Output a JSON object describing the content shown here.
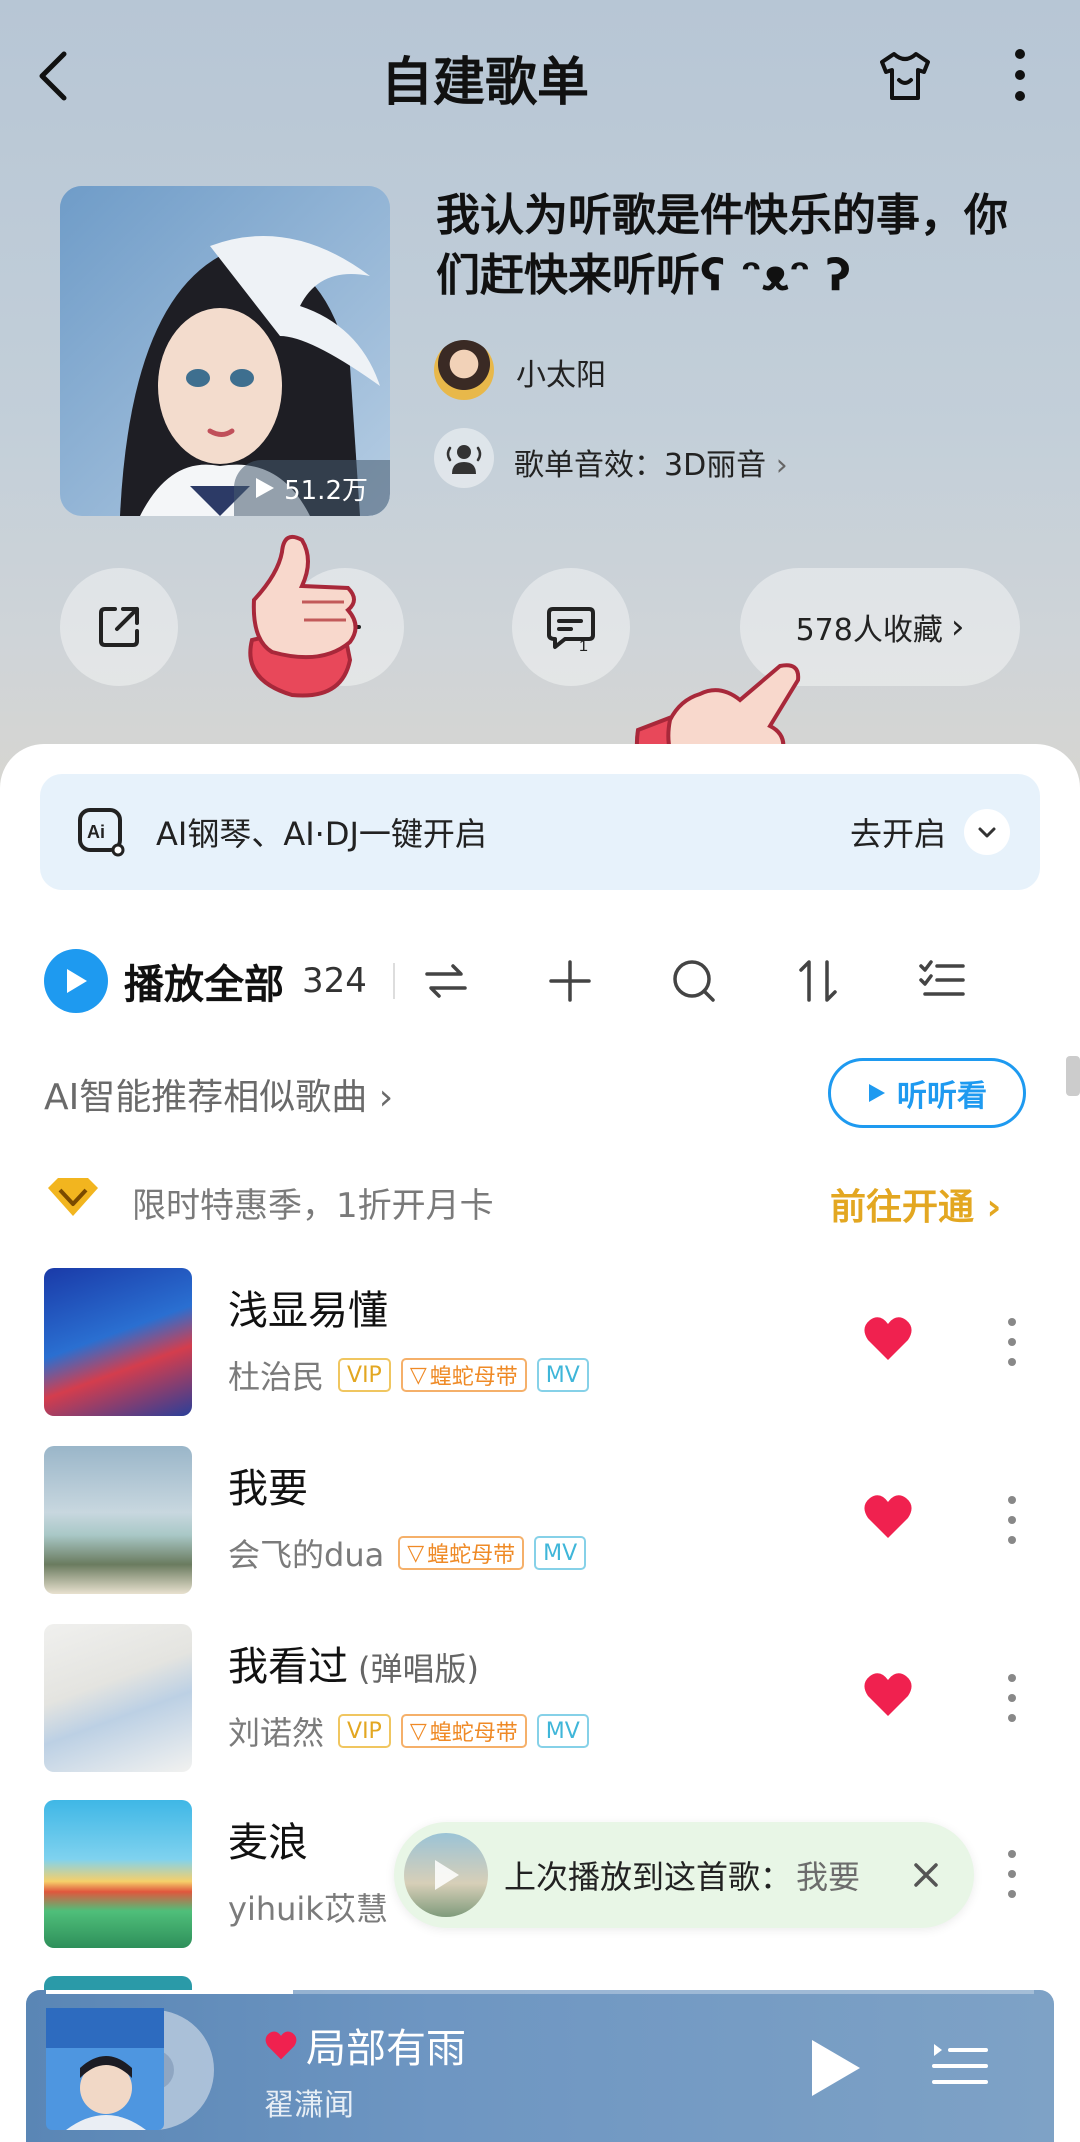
{
  "header": {
    "title": "自建歌单",
    "back_icon": "chevron-left-icon",
    "skin_icon": "tshirt-icon",
    "more_icon": "more-vertical-icon"
  },
  "playlist": {
    "title": "我认为听歌是件快乐的事，你们赶快来听听ʕ ᵔᴥᵔ ʔ",
    "play_count": "51.2万",
    "creator": "小太阳",
    "sound_effect": "歌单音效：3D丽音",
    "favorites": "578人收藏"
  },
  "actions": {
    "share_icon": "share-icon",
    "add_icon": "add-icon",
    "comment_icon": "comment-icon",
    "comment_count": "1"
  },
  "ai_bar": {
    "text": "AI钢琴、AI·DJ一键开启",
    "action": "去开启"
  },
  "toolbar": {
    "play_all": "播放全部",
    "count": "324"
  },
  "ai_recommend": {
    "text": "AI智能推荐相似歌曲 ›",
    "button": "听听看"
  },
  "promo": {
    "text": "限时特惠季，1折开月卡",
    "link": "前往开通 ›"
  },
  "songs": [
    {
      "name": "浅显易懂",
      "subtitle": "",
      "artist": "杜治民",
      "vip": "VIP",
      "theme": "蝗蛇母带",
      "mv": "MV",
      "liked": true
    },
    {
      "name": "我要",
      "subtitle": "",
      "artist": "会飞的dua",
      "vip": "",
      "theme": "蝗蛇母带",
      "mv": "MV",
      "liked": true
    },
    {
      "name": "我看过",
      "subtitle": "(弹唱版)",
      "artist": "刘诺然",
      "vip": "VIP",
      "theme": "蝗蛇母带",
      "mv": "MV",
      "liked": true
    },
    {
      "name": "麦浪",
      "subtitle": "",
      "artist": "yihuik苡慧",
      "vip": "",
      "theme": "",
      "mv": "",
      "liked": false
    }
  ],
  "resume_toast": {
    "label": "上次播放到这首歌：",
    "song": "我要"
  },
  "mini_player": {
    "title": "局部有雨",
    "artist": "翟潇闻",
    "progress": 0.25
  },
  "colors": {
    "accent_blue": "#1e9af0",
    "heart_red": "#f0214f",
    "vip_gold": "#e3a721",
    "theme_orange": "#ef8a26",
    "mv_cyan": "#3fb6d9"
  }
}
